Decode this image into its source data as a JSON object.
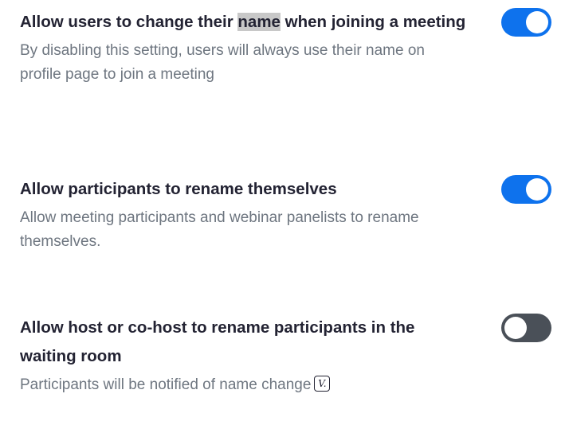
{
  "settings": [
    {
      "title_before": "Allow users to change their ",
      "title_highlight": "name",
      "title_after": " when joining a meeting",
      "description": "By disabling this setting, users will always use their name on profile page to join a meeting",
      "enabled": true
    },
    {
      "title": "Allow participants to rename themselves",
      "description": "Allow meeting participants and webinar panelists to rename themselves.",
      "enabled": true
    },
    {
      "title": "Allow host or co-host to rename participants in the waiting room",
      "description": "Participants will be notified of name change",
      "description_icon": "v-badge-icon",
      "description_icon_text": "V.",
      "enabled": false
    }
  ],
  "colors": {
    "toggle_on": "#0e72ed",
    "toggle_off": "#4a5058",
    "title_text": "#232333",
    "description_text": "#6e7680"
  }
}
